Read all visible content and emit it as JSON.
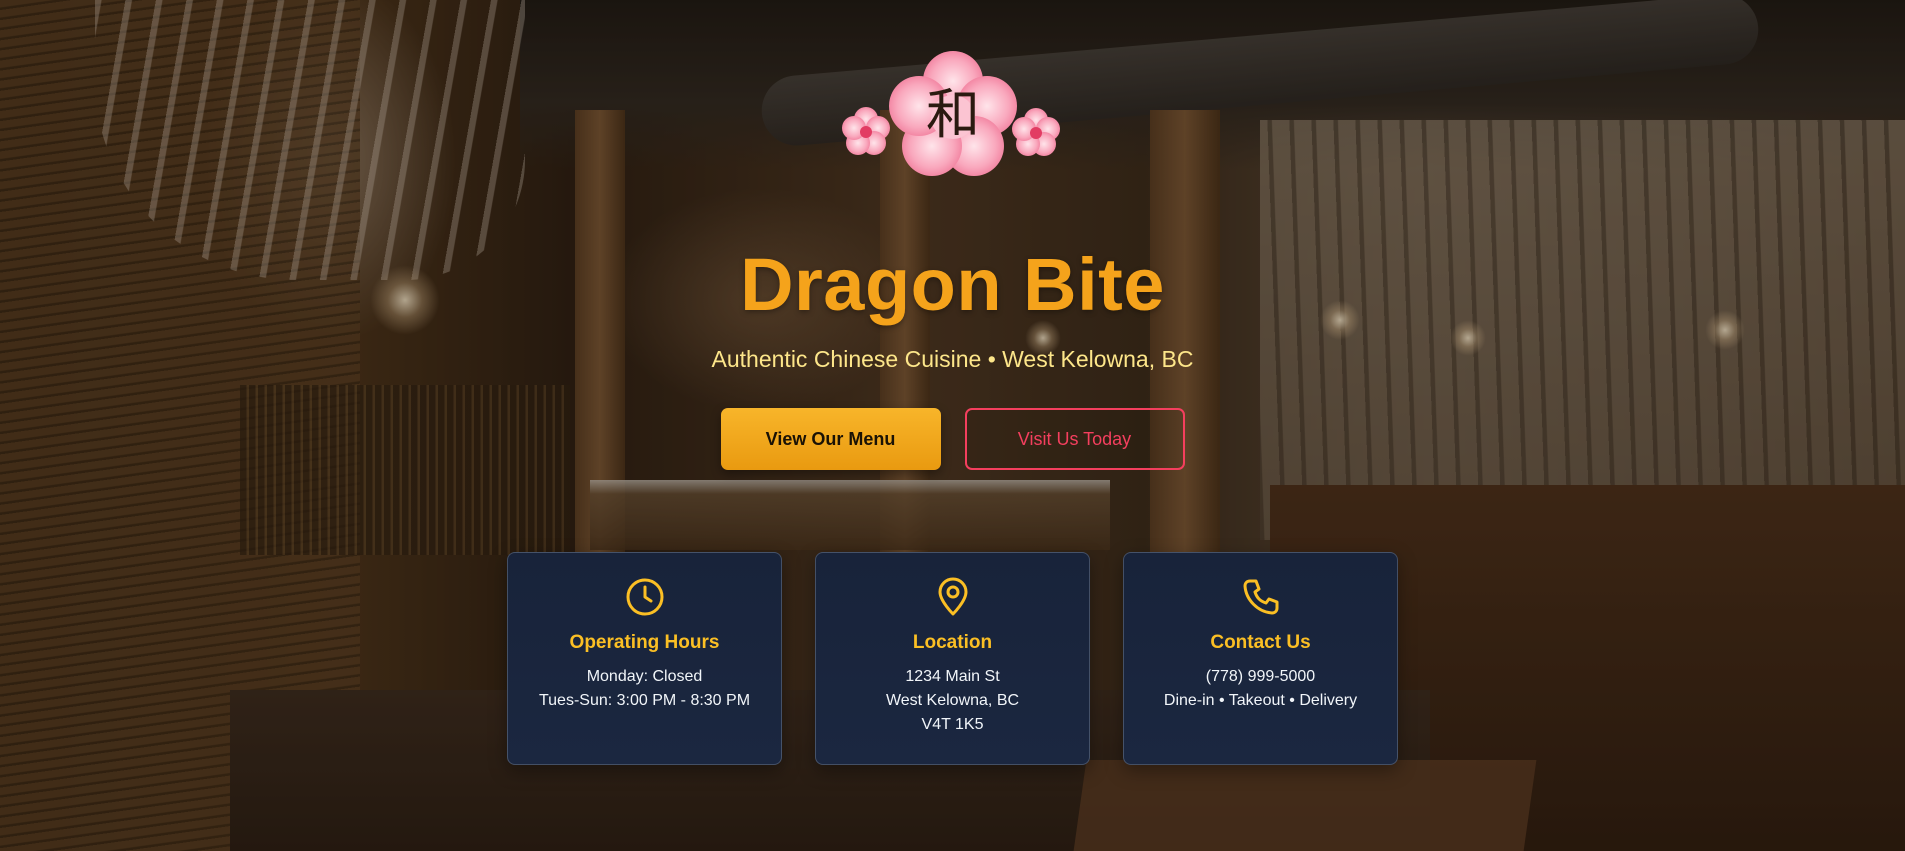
{
  "brand": {
    "logo_glyph": "和",
    "title": "Dragon Bite",
    "subtitle": "Authentic Chinese Cuisine • West Kelowna, BC"
  },
  "actions": {
    "primary_label": "View Our Menu",
    "secondary_label": "Visit Us Today"
  },
  "cards": [
    {
      "icon": "clock-icon",
      "title": "Operating Hours",
      "lines": [
        "Monday: Closed",
        "Tues-Sun: 3:00 PM - 8:30 PM"
      ]
    },
    {
      "icon": "map-pin-icon",
      "title": "Location",
      "lines": [
        "1234 Main St",
        "West Kelowna, BC",
        "V4T 1K5"
      ]
    },
    {
      "icon": "phone-icon",
      "title": "Contact Us",
      "lines": [
        "(778) 999-5000",
        "Dine-in • Takeout • Delivery"
      ]
    }
  ],
  "colors": {
    "accent": "#f5a31b",
    "subtitle": "#fde68a",
    "secondary_accent": "#f43f5e",
    "card_bg": "#18233a",
    "card_title": "#fbbf24"
  }
}
